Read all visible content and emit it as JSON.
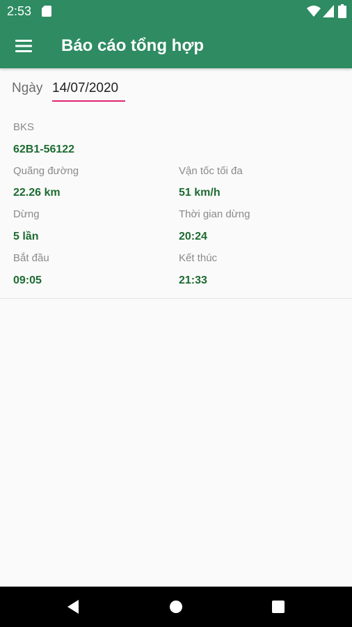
{
  "status_bar": {
    "time": "2:53",
    "icons": [
      "sd-card-icon",
      "wifi-icon",
      "signal-icon",
      "battery-icon"
    ]
  },
  "app_bar": {
    "title": "Báo cáo tổng hợp",
    "menu_icon": "hamburger-menu-icon"
  },
  "date_filter": {
    "label": "Ngày",
    "value": "14/07/2020"
  },
  "report": {
    "bks_label": "BKS",
    "bks_value": "62B1-56122",
    "distance_label": "Quãng đường",
    "distance_value": "22.26 km",
    "max_speed_label": "Vận tốc tối đa",
    "max_speed_value": "51 km/h",
    "stops_label": "Dừng",
    "stops_value": "5 lần",
    "stop_time_label": "Thời gian dừng",
    "stop_time_value": "20:24",
    "start_label": "Bắt đầu",
    "start_value": "09:05",
    "end_label": "Kết thúc",
    "end_value": "21:33"
  },
  "nav_bar": {
    "icons": [
      "back-icon",
      "home-icon",
      "recents-icon"
    ]
  },
  "colors": {
    "primary": "#2e8b62",
    "value_text": "#1d6b31",
    "label_text": "#8a8a8a",
    "date_underline": "#e0246f"
  }
}
